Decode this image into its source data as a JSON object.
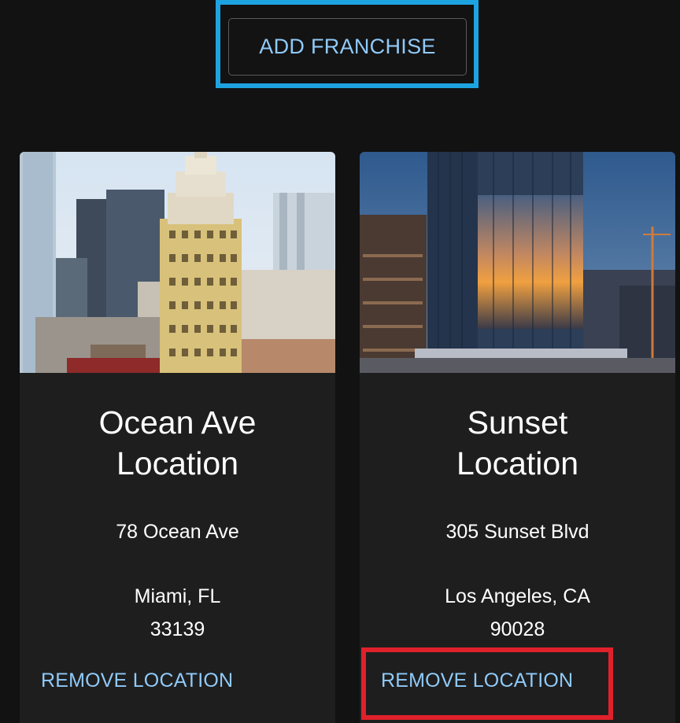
{
  "toolbar": {
    "add_label": "ADD FRANCHISE"
  },
  "cards": [
    {
      "title_line1": "Ocean Ave",
      "title_line2": "Location",
      "address": "78 Ocean Ave",
      "city_state": "Miami, FL",
      "zip": "33139",
      "remove_label": "REMOVE LOCATION"
    },
    {
      "title_line1": "Sunset",
      "title_line2": "Location",
      "address": "305 Sunset Blvd",
      "city_state": "Los Angeles, CA",
      "zip": "90028",
      "remove_label": "REMOVE LOCATION"
    }
  ],
  "colors": {
    "background": "#121212",
    "card": "#1e1e1e",
    "accent_text": "#90caf9",
    "highlight_blue": "#1ea3e1",
    "highlight_red": "#e0212b"
  }
}
